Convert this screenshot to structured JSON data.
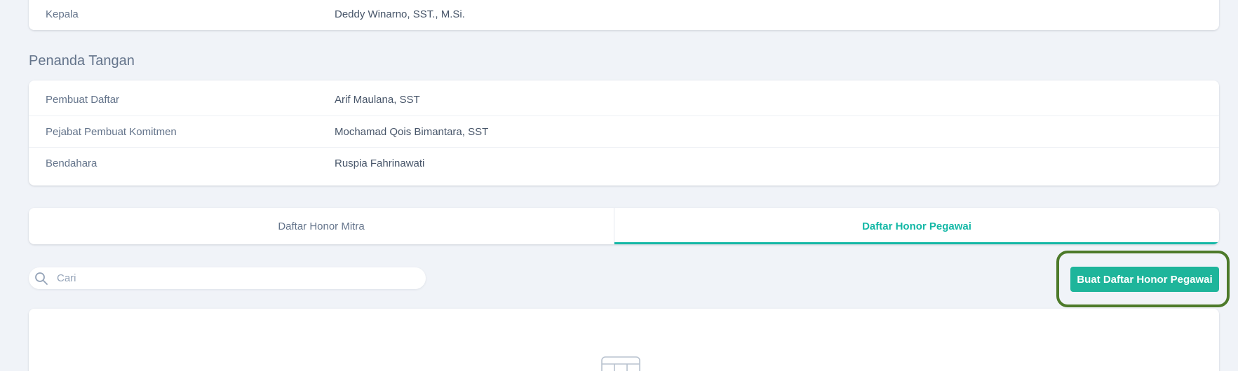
{
  "unit_info": {
    "rows": [
      {
        "label": "Kepala",
        "value": "Deddy Winarno, SST., M.Si."
      }
    ]
  },
  "signatories": {
    "title": "Penanda Tangan",
    "rows": [
      {
        "label": "Pembuat Daftar",
        "value": "Arif Maulana, SST"
      },
      {
        "label": "Pejabat Pembuat Komitmen",
        "value": "Mochamad Qois Bimantara, SST"
      },
      {
        "label": "Bendahara",
        "value": "Ruspia Fahrinawati"
      }
    ]
  },
  "tabs": [
    {
      "label": "Daftar Honor Mitra",
      "active": false
    },
    {
      "label": "Daftar Honor Pegawai",
      "active": true
    }
  ],
  "search": {
    "placeholder": "Cari",
    "value": "",
    "icon": "search-icon"
  },
  "actions": {
    "create_label": "Buat Daftar Honor Pegawai"
  },
  "empty_state": {
    "icon": "table-icon"
  },
  "colors": {
    "accent": "#14b8a6",
    "button": "#1eb59b",
    "highlight_border": "#4d7a2a",
    "background": "#f0f3f8"
  }
}
